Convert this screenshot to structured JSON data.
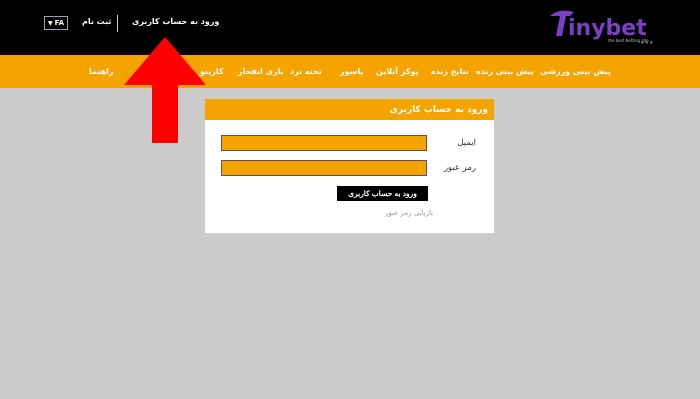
{
  "header": {
    "language": "FA",
    "register_label": "ثبت نام",
    "login_label": "ورود به حساب کاربری",
    "logo": {
      "brand": "Tinybet",
      "tagline": "the best betting site"
    }
  },
  "nav": {
    "items": [
      {
        "id": "sports-prediction",
        "label": "پیش بینی ورزشی"
      },
      {
        "id": "live-prediction",
        "label": "پیش بینی زنده"
      },
      {
        "id": "live-results",
        "label": "نتایج زنده"
      },
      {
        "id": "online-poker",
        "label": "پوکر آنلاین"
      },
      {
        "id": "pasur",
        "label": "پاسور"
      },
      {
        "id": "backgammon",
        "label": "تخته نرد"
      },
      {
        "id": "crash-game",
        "label": "بازی انفجار"
      },
      {
        "id": "casino",
        "label": "کازینو"
      },
      {
        "id": "help",
        "label": "راهنما"
      }
    ]
  },
  "login_panel": {
    "title": "ورود به حساب کاربری",
    "email_label": "ایمیل",
    "email_value": "",
    "password_label": "رمز عبور",
    "password_value": "",
    "submit_label": "ورود به حساب کاربری",
    "forgot_label": "بازیابی رمز عبور"
  },
  "colors": {
    "accent": "#f5a300",
    "annotation_arrow": "#ff0000",
    "logo_purple": "#7a3fc4"
  }
}
